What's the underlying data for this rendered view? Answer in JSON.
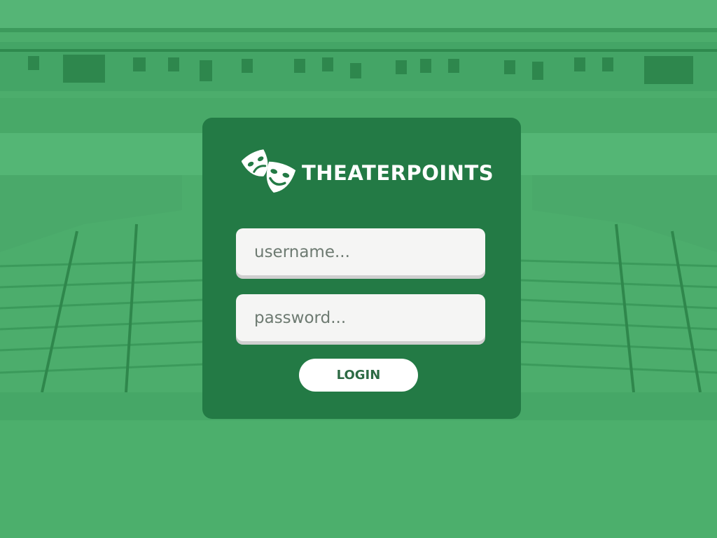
{
  "app": {
    "brand_name": "THEATERPOINTS",
    "logo_icon": "theater-masks-icon"
  },
  "login_form": {
    "username_placeholder": "username...",
    "password_placeholder": "password...",
    "login_label": "LOGIN"
  },
  "colors": {
    "background_tint": "#4cad6c",
    "card_background": "#237a45",
    "field_background": "#f5f5f4",
    "button_background": "#ffffff",
    "button_text": "#2d6a44"
  }
}
